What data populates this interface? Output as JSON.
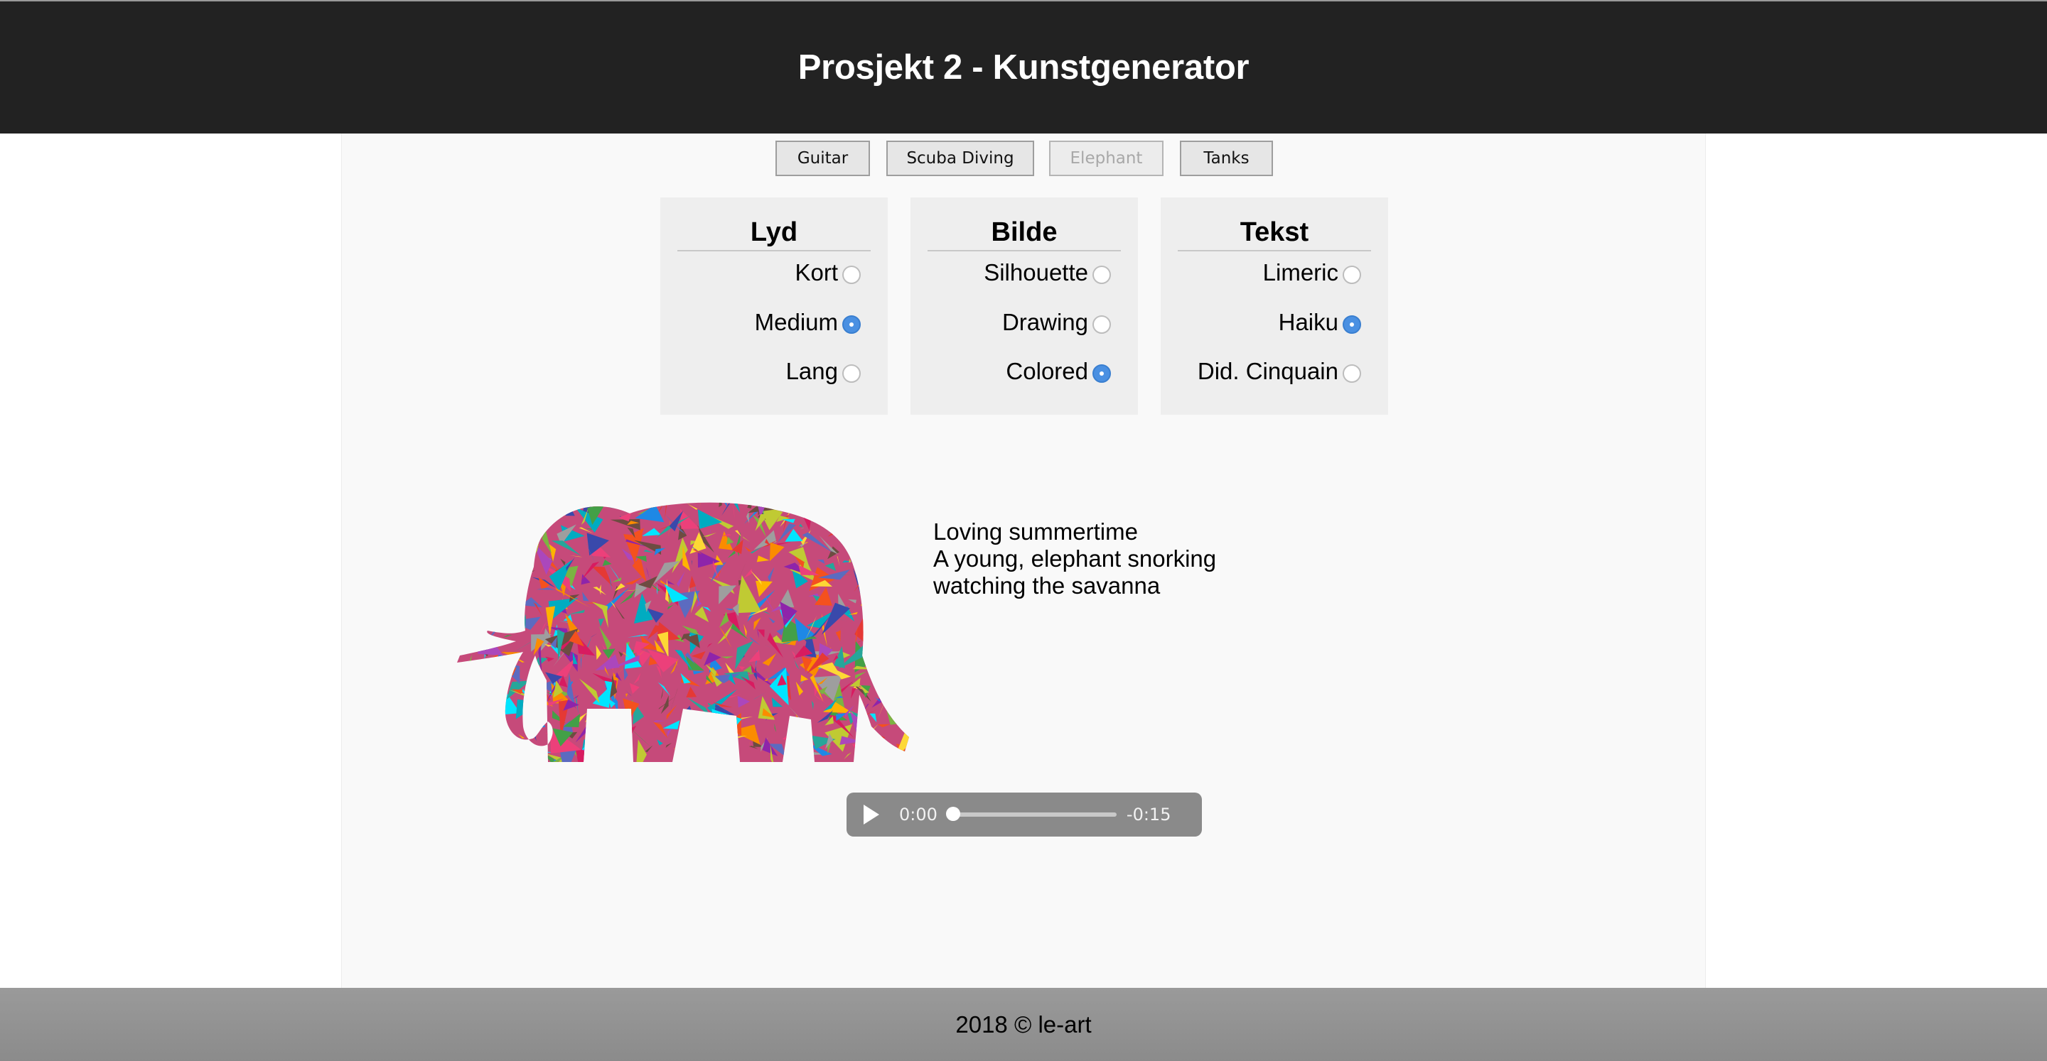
{
  "header": {
    "title": "Prosjekt 2 - Kunstgenerator"
  },
  "tabs": [
    {
      "label": "Guitar",
      "disabled": false
    },
    {
      "label": "Scuba Diving",
      "disabled": false
    },
    {
      "label": "Elephant",
      "disabled": true
    },
    {
      "label": "Tanks",
      "disabled": false
    }
  ],
  "panels": {
    "lyd": {
      "title": "Lyd",
      "options": [
        "Kort",
        "Medium",
        "Lang"
      ],
      "selected": "Medium"
    },
    "bilde": {
      "title": "Bilde",
      "options": [
        "Silhouette",
        "Drawing",
        "Colored"
      ],
      "selected": "Colored"
    },
    "tekst": {
      "title": "Tekst",
      "options": [
        "Limeric",
        "Haiku",
        "Did. Cinquain"
      ],
      "selected": "Haiku"
    }
  },
  "poem": {
    "lines": [
      "Loving summertime",
      "A young, elephant snorking",
      "watching the savanna"
    ]
  },
  "player": {
    "current": "0:00",
    "remaining": "-0:15",
    "progress": 0
  },
  "footer": {
    "text": "2018 © le-art"
  },
  "colors": {
    "header_bg": "#222222",
    "footer_bg": "#8f8f8f",
    "radio_checked": "#4a90e2"
  }
}
